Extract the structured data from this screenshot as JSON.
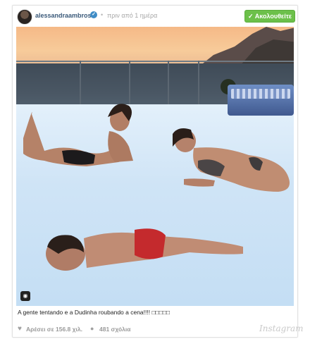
{
  "post": {
    "username": "alessandraambrosio",
    "separator": "•",
    "time_ago": "πριν από 1 ημέρα",
    "follow_label": "Ακολουθείτε",
    "follow_check": "✓",
    "caption": "A gente tentando e a Dudinha roubando a cena!!!! □□□□□",
    "likes": "Αρέσει σε 156.8 χιλ.",
    "comments": "481 σχόλια",
    "brand": "Instagram"
  },
  "icons": {
    "verified": "verified-badge-icon",
    "heart": "heart-icon",
    "comment": "comment-icon",
    "camera": "instagram-camera-icon"
  },
  "colors": {
    "follow_button": "#6cc04a",
    "username": "#3b5a7a",
    "verified": "#3f8cc6"
  }
}
